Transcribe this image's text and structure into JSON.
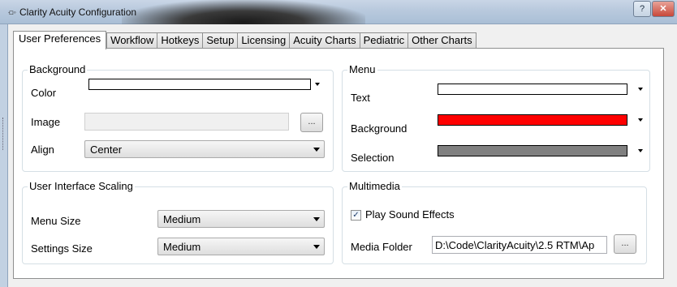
{
  "window": {
    "icon": "app-icon",
    "title": "Clarity Acuity Configuration",
    "help_label": "?",
    "close_label": "✕"
  },
  "tabs": [
    {
      "label": "User Preferences",
      "active": true
    },
    {
      "label": "Workflow"
    },
    {
      "label": "Hotkeys"
    },
    {
      "label": "Setup"
    },
    {
      "label": "Licensing"
    },
    {
      "label": "Acuity Charts"
    },
    {
      "label": "Pediatric"
    },
    {
      "label": "Other Charts"
    }
  ],
  "background": {
    "title": "Background",
    "color_label": "Color",
    "color_value": "#ffffff",
    "image_label": "Image",
    "image_value": "",
    "browse_label": "...",
    "align_label": "Align",
    "align_value": "Center"
  },
  "menu": {
    "title": "Menu",
    "text_label": "Text",
    "text_color": "#ffffff",
    "background_label": "Background",
    "background_color": "#ff0000",
    "selection_label": "Selection",
    "selection_color": "#808080"
  },
  "scaling": {
    "title": "User Interface Scaling",
    "menu_size_label": "Menu Size",
    "menu_size_value": "Medium",
    "settings_size_label": "Settings Size",
    "settings_size_value": "Medium"
  },
  "multimedia": {
    "title": "Multimedia",
    "play_sound_label": "Play Sound Effects",
    "play_sound_checked": true,
    "check_glyph": "✓",
    "media_folder_label": "Media Folder",
    "media_folder_value": "D:\\Code\\ClarityAcuity\\2.5 RTM\\Ap",
    "browse_label": "..."
  }
}
